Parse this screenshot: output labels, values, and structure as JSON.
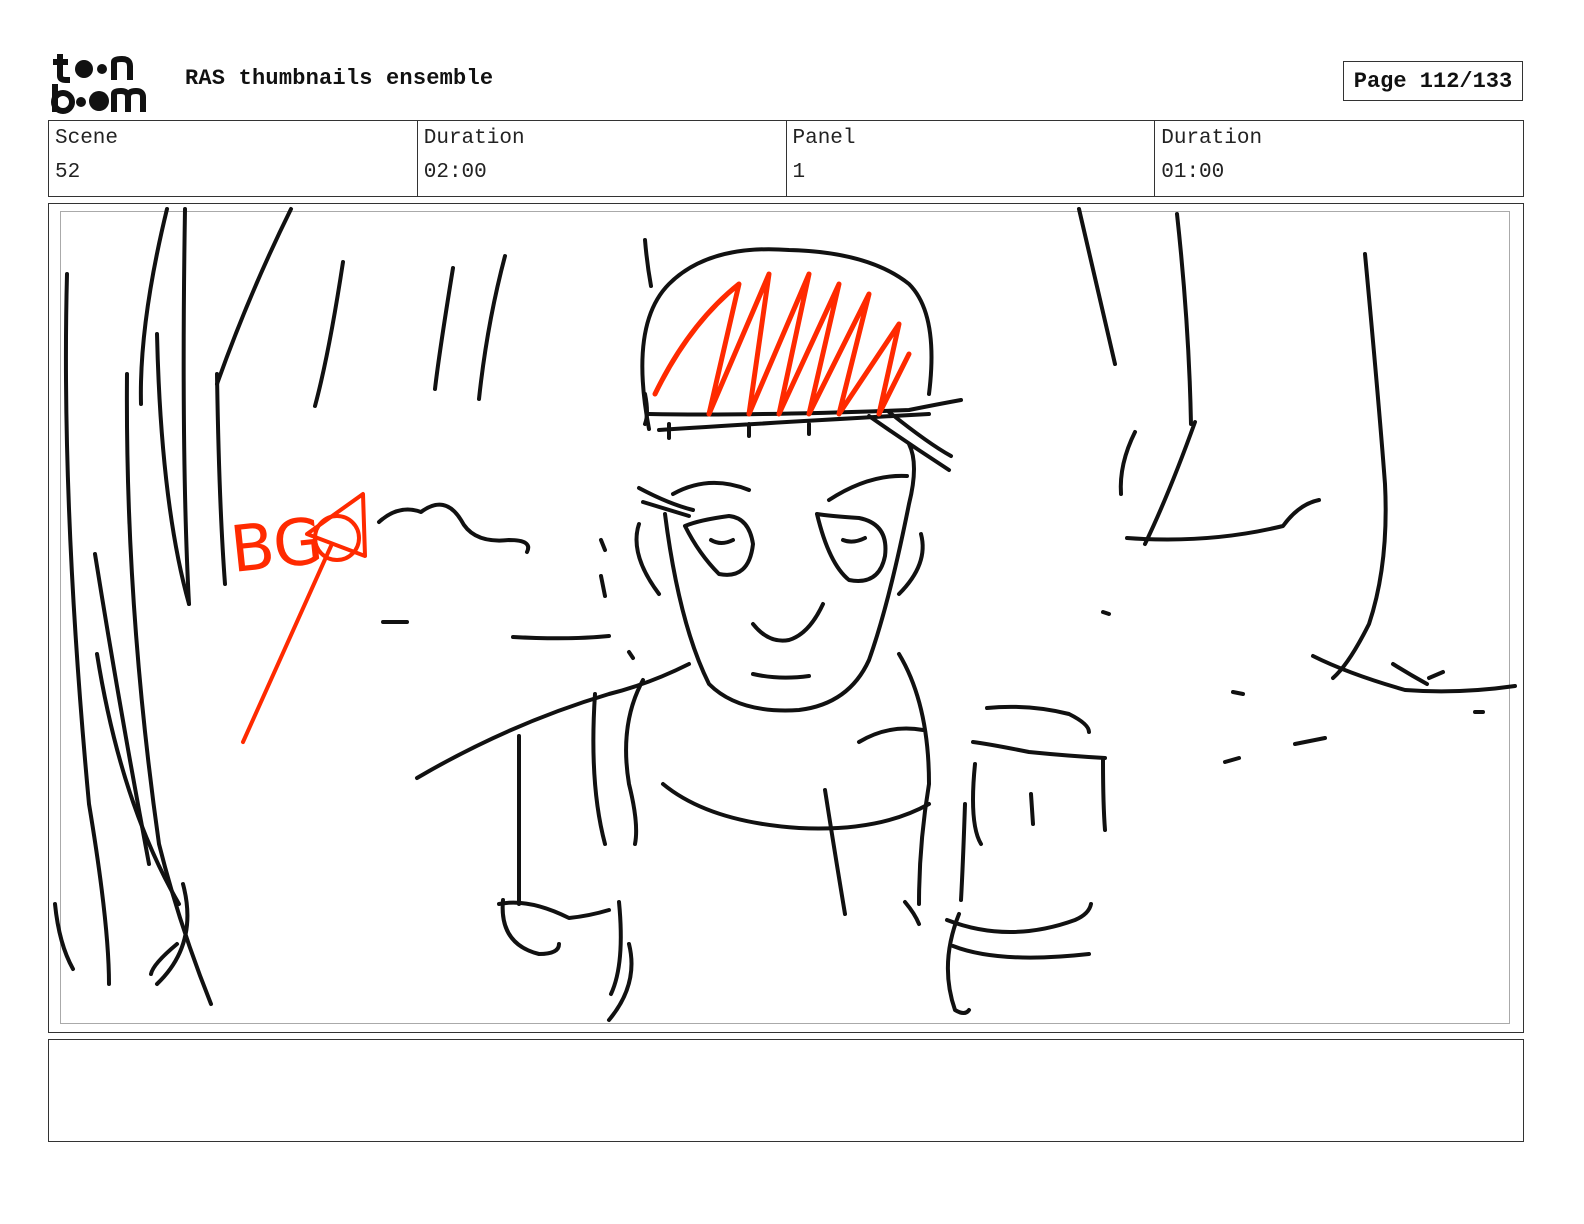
{
  "header": {
    "logo_alt": "toon boom",
    "title": "RAS thumbnails ensemble",
    "page_label": "Page 112/133"
  },
  "info": {
    "scene_label": "Scene",
    "scene_value": "52",
    "scene_duration_label": "Duration",
    "scene_duration_value": "02:00",
    "panel_label": "Panel",
    "panel_value": "1",
    "panel_duration_label": "Duration",
    "panel_duration_value": "01:00"
  },
  "panel": {
    "annotation_text": "BG",
    "annotation_color": "#ff2a00",
    "ink_color": "#111111"
  },
  "notes": {
    "text": ""
  }
}
